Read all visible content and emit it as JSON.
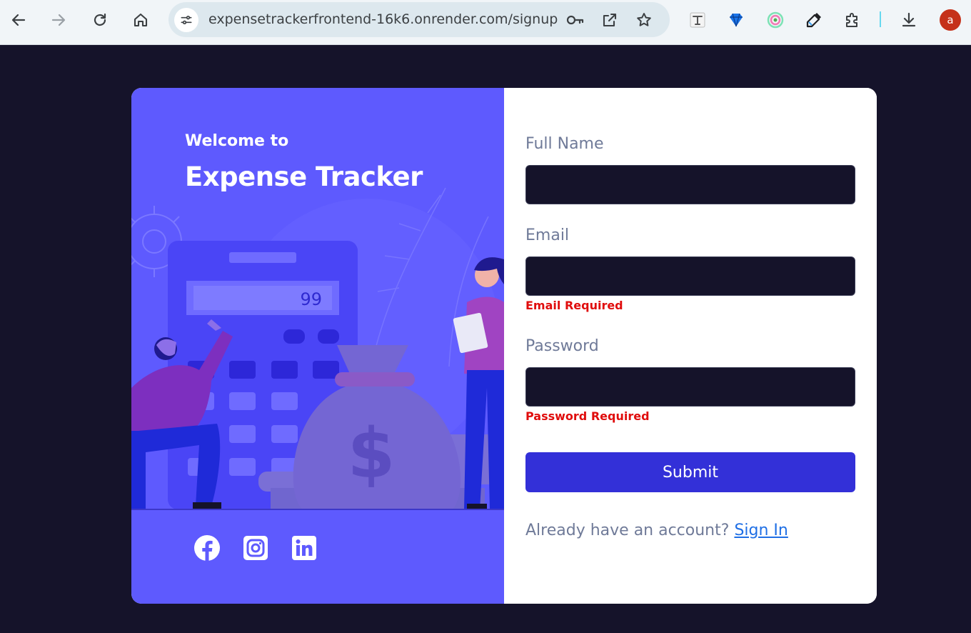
{
  "browser": {
    "url": "expensetrackerfrontend-16k6.onrender.com/signup",
    "profile_initial": "a"
  },
  "welcome": {
    "line1": "Welcome to",
    "line2": "Expense Tracker",
    "calculator_display": "99"
  },
  "form": {
    "full_name": {
      "label": "Full Name",
      "value": "",
      "error": ""
    },
    "email": {
      "label": "Email",
      "value": "",
      "error": "Email Required"
    },
    "password": {
      "label": "Password",
      "value": "",
      "error": "Password Required"
    },
    "submit_label": "Submit"
  },
  "signin": {
    "prompt": "Already have an account?",
    "link_label": "Sign In"
  },
  "colors": {
    "page_bg": "#15132a",
    "left_panel": "#5e5afe",
    "submit": "#3330d8",
    "error": "#e00d0d",
    "link": "#1f6fe5"
  },
  "social": [
    "facebook-icon",
    "instagram-icon",
    "linkedin-icon"
  ]
}
